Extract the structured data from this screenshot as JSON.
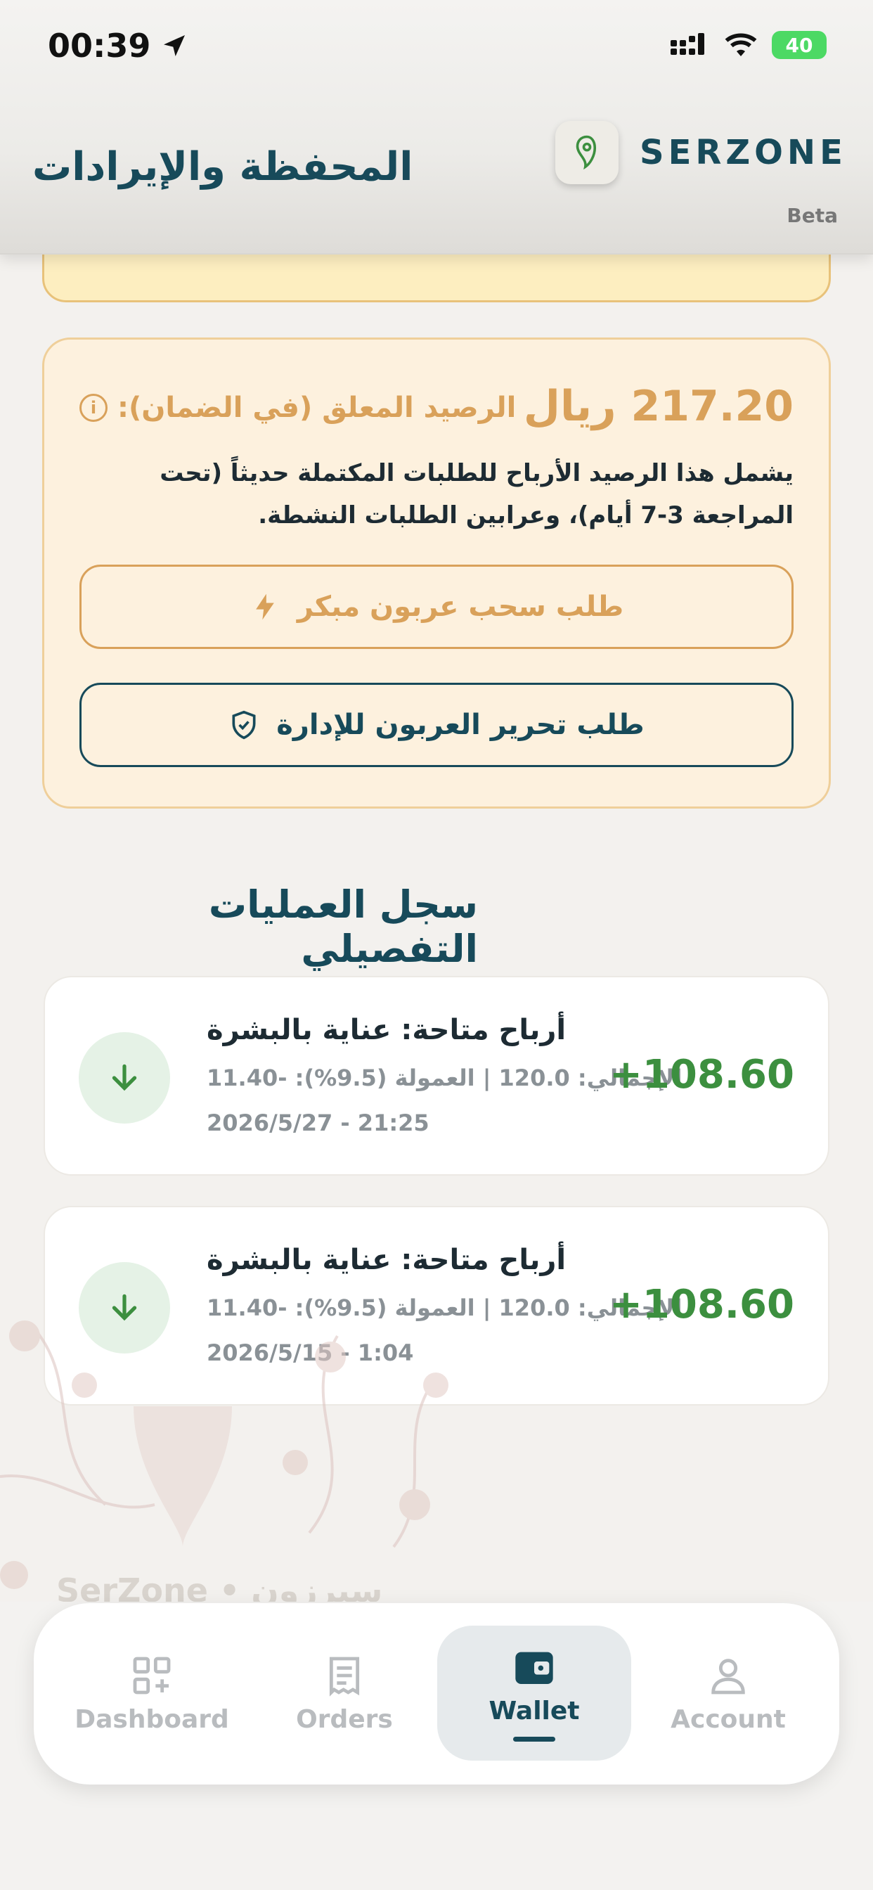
{
  "status_bar": {
    "time": "00:39",
    "battery": "40"
  },
  "header": {
    "title": "المحفظة والإيرادات",
    "brand": "SERZONE",
    "beta": "Beta"
  },
  "pending": {
    "amount": "217.20 ريال",
    "label": "الرصيد المعلق (في الضمان):",
    "description": "يشمل هذا الرصيد الأرباح للطلبات المكتملة حديثاً (تحت المراجعة 3-7 أيام)، وعرابين الطلبات النشطة.",
    "early_withdraw_label": "طلب سحب عربون مبكر",
    "release_label": "طلب تحرير العربون للإدارة"
  },
  "history": {
    "title": "سجل العمليات التفصيلي",
    "items": [
      {
        "title": "أرباح متاحة: عناية بالبشرة",
        "detail": "الإجمالي: 120.0 | العمولة (9.5%): -11.40",
        "date": "2026/5/27 - 21:25",
        "amount": "+108.60"
      },
      {
        "title": "أرباح متاحة: عناية بالبشرة",
        "detail": "الإجمالي: 120.0 | العمولة (9.5%): -11.40",
        "date": "2026/5/15 - 1:04",
        "amount": "+108.60"
      }
    ]
  },
  "background": {
    "brand": "SerZone • سيرزون"
  },
  "nav": {
    "items": [
      {
        "label": "Dashboard",
        "icon": "grid-plus-icon"
      },
      {
        "label": "Orders",
        "icon": "receipt-icon"
      },
      {
        "label": "Wallet",
        "icon": "wallet-icon"
      },
      {
        "label": "Account",
        "icon": "person-icon"
      }
    ],
    "active": "Wallet"
  },
  "colors": {
    "primary": "#174a5a",
    "gold": "#d9a15a",
    "green": "#3c8f3f",
    "pending_bg": "#fdf1de"
  }
}
